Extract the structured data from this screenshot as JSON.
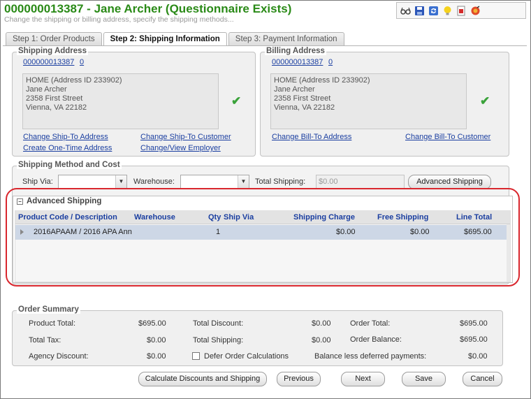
{
  "header": {
    "title": "000000013387 - Jane Archer (Questionnaire Exists)",
    "subtitle": "Change the shipping or billing address, specify the shipping methods..."
  },
  "toolbar": {
    "icons": [
      "glasses-icon",
      "save-icon",
      "refresh-icon",
      "lightbulb-icon",
      "report-icon",
      "delete-icon"
    ]
  },
  "tabs": [
    {
      "label": "Step 1: Order Products",
      "active": false
    },
    {
      "label": "Step 2: Shipping Information",
      "active": true
    },
    {
      "label": "Step 3: Payment Information",
      "active": false
    }
  ],
  "shipping_address": {
    "title": "Shipping Address",
    "id_link": "000000013387",
    "count_link": "0",
    "lines": [
      "HOME (Address ID 233902)",
      "Jane Archer",
      "2358 First Street",
      "Vienna, VA 22182"
    ],
    "links": [
      "Change Ship-To Address",
      "Change Ship-To Customer",
      "Create One-Time Address",
      "Change/View Employer"
    ]
  },
  "billing_address": {
    "title": "Billing Address",
    "id_link": "000000013387",
    "count_link": "0",
    "lines": [
      "HOME (Address ID 233902)",
      "Jane Archer",
      "2358 First Street",
      "Vienna, VA 22182"
    ],
    "links": [
      "Change Bill-To Address",
      "Change Bill-To Customer"
    ]
  },
  "shipping_method": {
    "title": "Shipping Method and Cost",
    "ship_via_label": "Ship Via:",
    "warehouse_label": "Warehouse:",
    "total_shipping_label": "Total Shipping:",
    "total_shipping_placeholder": "$0.00",
    "advanced_button": "Advanced Shipping"
  },
  "advanced_shipping": {
    "title": "Advanced Shipping",
    "columns": [
      "Product Code / Description",
      "Warehouse",
      "Qty",
      "Ship Via",
      "Shipping Charge",
      "Free Shipping",
      "Line Total"
    ],
    "rows": [
      {
        "product": "2016APAAM / 2016 APA Ann",
        "warehouse": "",
        "qty": "1",
        "ship_via": "",
        "shipping_charge": "$0.00",
        "free_shipping": "$0.00",
        "line_total": "$695.00"
      }
    ]
  },
  "order_summary": {
    "title": "Order Summary",
    "product_total_label": "Product Total:",
    "product_total": "$695.00",
    "total_tax_label": "Total Tax:",
    "total_tax": "$0.00",
    "agency_discount_label": "Agency Discount:",
    "agency_discount": "$0.00",
    "total_discount_label": "Total Discount:",
    "total_discount": "$0.00",
    "total_shipping_label": "Total Shipping:",
    "total_shipping": "$0.00",
    "defer_label": "Defer Order Calculations",
    "order_total_label": "Order Total:",
    "order_total": "$695.00",
    "order_balance_label": "Order Balance:",
    "order_balance": "$695.00",
    "balance_deferred_label": "Balance less deferred payments:",
    "balance_deferred": "$0.00"
  },
  "buttons": {
    "calculate": "Calculate Discounts and Shipping",
    "previous": "Previous",
    "next": "Next",
    "save": "Save",
    "cancel": "Cancel"
  },
  "colors": {
    "title_green": "#2a8a17",
    "link_blue": "#1a3ea0",
    "highlight_red": "#d9272e",
    "check_green": "#3aa23a",
    "row_selected": "#cdd7e6"
  }
}
